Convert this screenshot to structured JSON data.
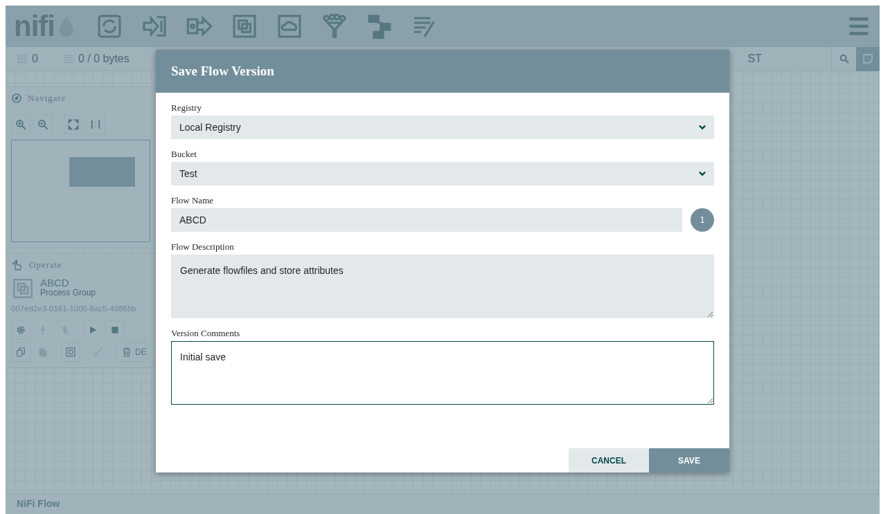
{
  "header": {
    "logo": "nifi"
  },
  "status_bar": {
    "stats": [
      {
        "kind": "components",
        "text": "0"
      },
      {
        "kind": "queued",
        "text": "0 / 0 bytes"
      }
    ],
    "partial_text": "ST"
  },
  "navigate": {
    "title": "Navigate"
  },
  "operate": {
    "title": "Operate",
    "component_name": "ABCD",
    "component_type": "Process Group",
    "component_id": "007ed2e3-0161-1000-8ac5-49855b",
    "buttons": [
      {
        "kind": "configure",
        "disabled": false
      },
      {
        "kind": "enable",
        "disabled": true
      },
      {
        "kind": "disable",
        "disabled": true
      },
      {
        "kind": "start",
        "disabled": false
      },
      {
        "kind": "stop",
        "disabled": false
      },
      {
        "kind": "copy",
        "disabled": false
      },
      {
        "kind": "paste",
        "disabled": true
      },
      {
        "kind": "group",
        "disabled": false
      },
      {
        "kind": "color",
        "disabled": true
      },
      {
        "kind": "delete",
        "disabled": false,
        "label": "DE"
      }
    ]
  },
  "dialog": {
    "title": "Save Flow Version",
    "fields": [
      {
        "kind": "select",
        "label": "Registry",
        "value": "Local Registry"
      },
      {
        "kind": "select",
        "label": "Bucket",
        "value": "Test"
      },
      {
        "kind": "text",
        "label": "Flow Name",
        "value": "ABCD",
        "badge": "1"
      },
      {
        "kind": "textarea",
        "label": "Flow Description",
        "value": "Generate flowfiles and store attributes",
        "focused": false
      },
      {
        "kind": "textarea",
        "label": "Version Comments",
        "value": "Initial save",
        "focused": true
      }
    ],
    "buttons": [
      {
        "kind": "secondary",
        "label": "CANCEL"
      },
      {
        "kind": "primary",
        "label": "SAVE"
      }
    ]
  },
  "breadcrumb": {
    "text": "NiFi Flow"
  }
}
